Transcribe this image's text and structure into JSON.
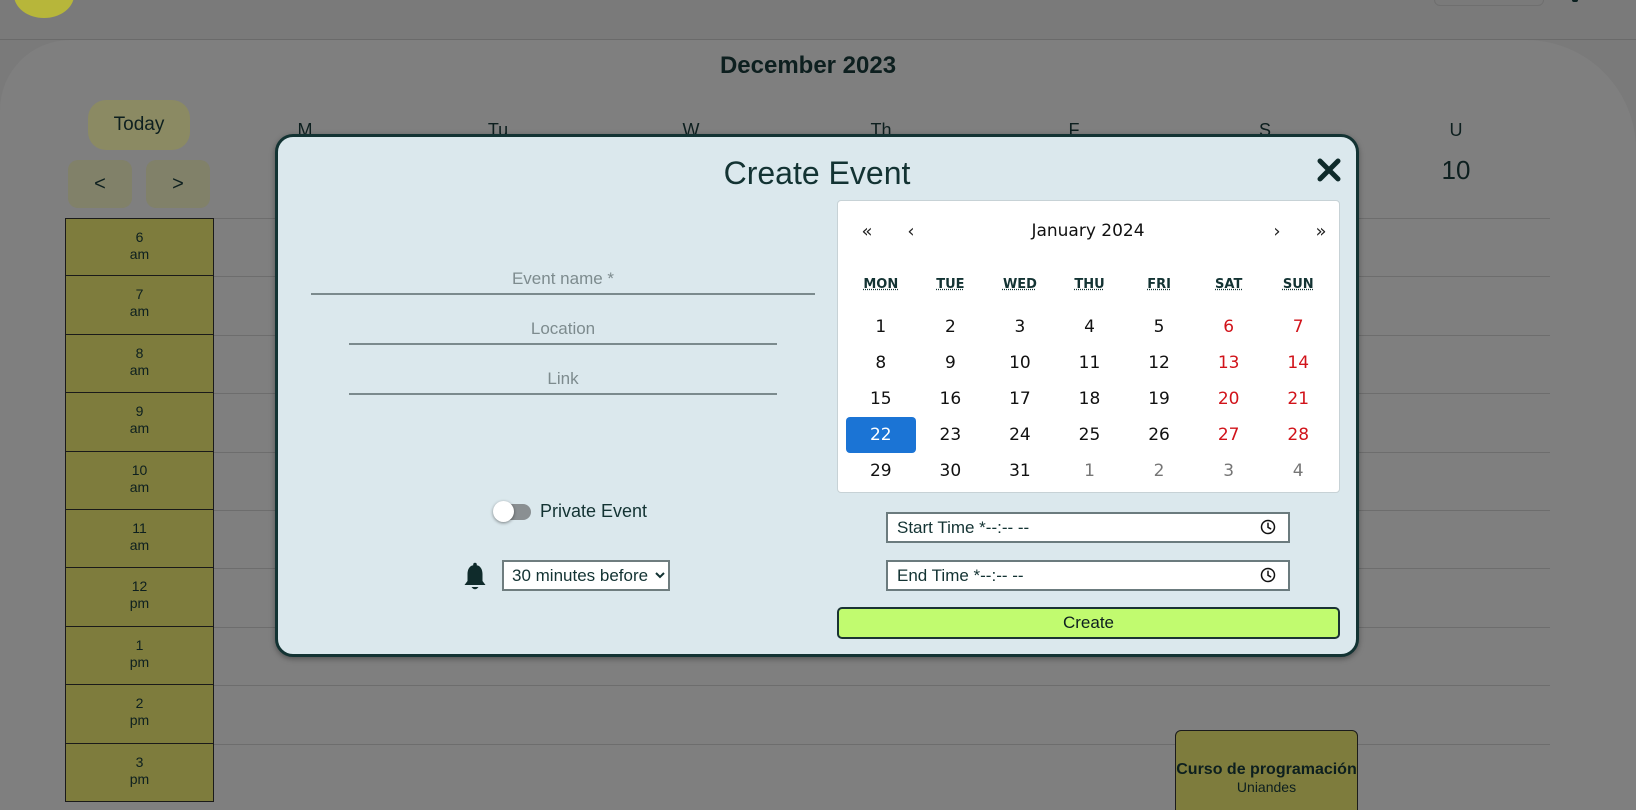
{
  "background": {
    "month_title": "December 2023",
    "today_label": "Today",
    "prev_label": "<",
    "next_label": ">",
    "day_headers": [
      "M",
      "Tu",
      "W",
      "Th",
      "F",
      "S",
      "U"
    ],
    "visible_day_number": "10",
    "hours": [
      {
        "num": "6",
        "period": "am"
      },
      {
        "num": "7",
        "period": "am"
      },
      {
        "num": "8",
        "period": "am"
      },
      {
        "num": "9",
        "period": "am"
      },
      {
        "num": "10",
        "period": "am"
      },
      {
        "num": "11",
        "period": "am"
      },
      {
        "num": "12",
        "period": "pm"
      },
      {
        "num": "1",
        "period": "pm"
      },
      {
        "num": "2",
        "period": "pm"
      },
      {
        "num": "3",
        "period": "pm"
      }
    ],
    "event": {
      "title": "Curso de programación",
      "subtitle": "Uniandes"
    }
  },
  "modal": {
    "title": "Create Event",
    "close_icon": "close-icon",
    "name_placeholder": "Event name *",
    "location_placeholder": "Location",
    "link_placeholder": "Link",
    "private_label": "Private Event",
    "private_enabled": false,
    "bell_icon": "bell-icon",
    "reminder_selected": "30 minutes before",
    "start_time_label": "Start Time *--:-- --",
    "end_time_label": "End Time *--:-- --",
    "clock_icon": "clock-icon",
    "create_label": "Create",
    "accent_color": "#c1fb6f"
  },
  "date_picker": {
    "nav": {
      "prev2": "«",
      "prev": "‹",
      "next": "›",
      "next2": "»"
    },
    "month_label": "January 2024",
    "weekdays": [
      "MON",
      "TUE",
      "WED",
      "THU",
      "FRI",
      "SAT",
      "SUN"
    ],
    "days": [
      {
        "d": "1"
      },
      {
        "d": "2"
      },
      {
        "d": "3"
      },
      {
        "d": "4"
      },
      {
        "d": "5"
      },
      {
        "d": "6",
        "weekend": true
      },
      {
        "d": "7",
        "weekend": true
      },
      {
        "d": "8"
      },
      {
        "d": "9"
      },
      {
        "d": "10"
      },
      {
        "d": "11"
      },
      {
        "d": "12"
      },
      {
        "d": "13",
        "weekend": true
      },
      {
        "d": "14",
        "weekend": true
      },
      {
        "d": "15"
      },
      {
        "d": "16"
      },
      {
        "d": "17"
      },
      {
        "d": "18"
      },
      {
        "d": "19"
      },
      {
        "d": "20",
        "weekend": true
      },
      {
        "d": "21",
        "weekend": true
      },
      {
        "d": "22",
        "selected": true
      },
      {
        "d": "23"
      },
      {
        "d": "24"
      },
      {
        "d": "25"
      },
      {
        "d": "26"
      },
      {
        "d": "27",
        "weekend": true
      },
      {
        "d": "28",
        "weekend": true
      },
      {
        "d": "29"
      },
      {
        "d": "30"
      },
      {
        "d": "31"
      },
      {
        "d": "1",
        "other": true
      },
      {
        "d": "2",
        "other": true
      },
      {
        "d": "3",
        "other": true
      },
      {
        "d": "4",
        "other": true
      }
    ],
    "selected_color": "#1b74d5",
    "weekend_color": "#d1131a"
  }
}
